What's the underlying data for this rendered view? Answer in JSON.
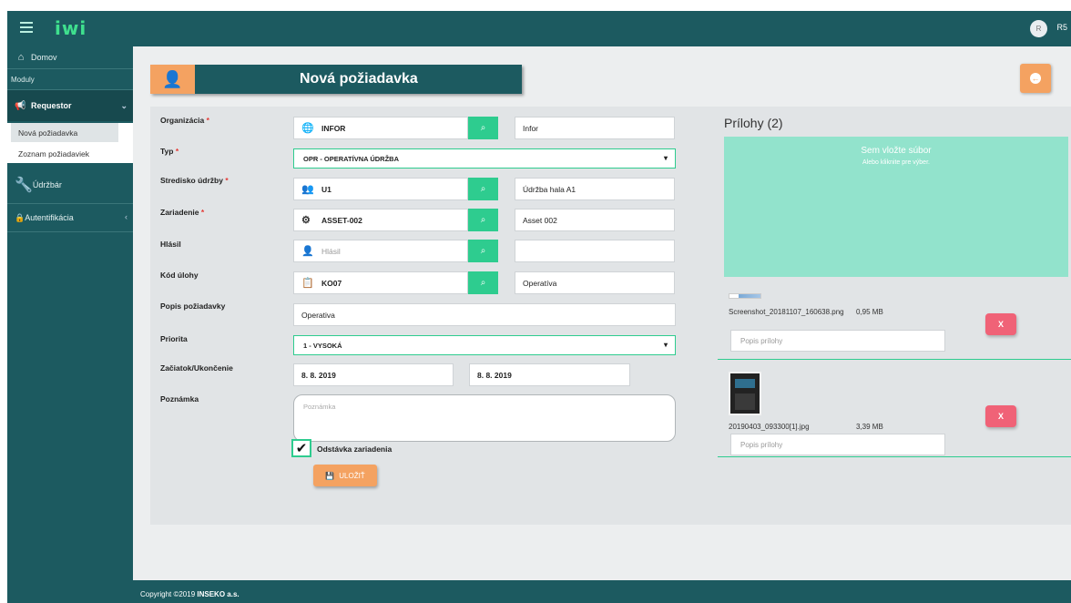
{
  "topbar": {
    "logo": "iwi",
    "user_avatar": "R",
    "user_initials": "R5"
  },
  "sidebar": {
    "home": "Domov",
    "modules": "Moduly",
    "requestor": "Requestor",
    "sub_items": [
      "Nová požiadavka",
      "Zoznam požiadaviek"
    ],
    "maintainer": "Údržbár",
    "auth": "Autentifikácia"
  },
  "header": {
    "title": "Nová požiadavka"
  },
  "form": {
    "org_label": "Organizácia",
    "org_value": "INFOR",
    "org_desc": "Infor",
    "type_label": "Typ",
    "type_value": "OPR - OPERATÍVNA ÚDRŽBA",
    "center_label": "Stredisko údržby",
    "center_value": "U1",
    "center_desc": "Údržba hala A1",
    "device_label": "Zariadenie",
    "device_value": "ASSET-002",
    "device_desc": "Asset 002",
    "reported_label": "Hlásil",
    "reported_placeholder": "Hlásil",
    "task_label": "Kód úlohy",
    "task_value": "KO07",
    "task_desc": "Operatíva",
    "desc_label": "Popis požiadavky",
    "desc_value": "Operativa",
    "priority_label": "Priorita",
    "priority_value": "1 - VYSOKÁ",
    "dates_label": "Začiatok/Ukončenie",
    "start_date": "8. 8. 2019",
    "end_date": "8. 8. 2019",
    "note_label": "Poznámka",
    "note_placeholder": "Poznámka",
    "shutdown_label": "Odstávka zariadenia",
    "shutdown_checked": true,
    "save_label": "ULOŽIŤ"
  },
  "attachments": {
    "title": "Prílohy (2)",
    "drop_main": "Sem vložte súbor",
    "drop_sub": "Alebo kliknite pre výber.",
    "files": [
      {
        "name": "Screenshot_20181107_160638.png",
        "size": "0,95 MB",
        "desc_placeholder": "Popis prílohy",
        "remove": "X"
      },
      {
        "name": "20190403_093300[1].jpg",
        "size": "3,39 MB",
        "desc_placeholder": "Popis prílohy",
        "remove": "X"
      }
    ]
  },
  "footer": {
    "prefix": "Copyright ©2019 ",
    "company": "INSEKO a.s."
  },
  "colors": {
    "teal": "#1c5a60",
    "orange": "#f4a261",
    "green": "#2ecc8f",
    "red": "#f06277"
  }
}
